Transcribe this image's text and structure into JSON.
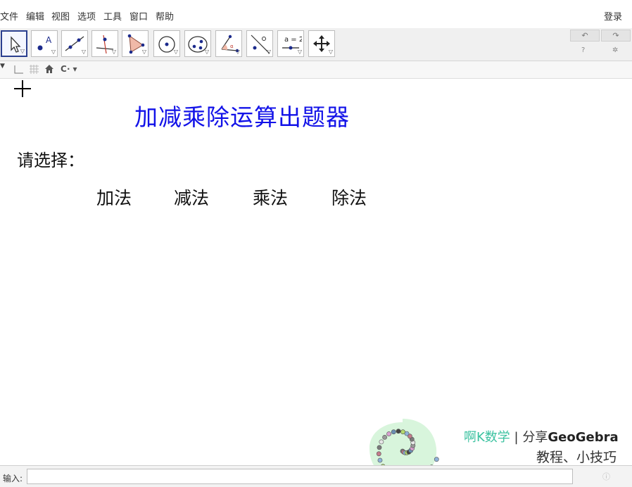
{
  "menu": {
    "items": [
      "文件",
      "编辑",
      "视图",
      "选项",
      "工具",
      "窗口",
      "帮助"
    ],
    "login": "登录"
  },
  "toolbar": {
    "tools": [
      {
        "name": "move-tool",
        "icon": "pointer-arrow-icon"
      },
      {
        "name": "point-tool",
        "icon": "point-icon"
      },
      {
        "name": "line-tool",
        "icon": "line-icon"
      },
      {
        "name": "perpendicular-tool",
        "icon": "perpendicular-icon"
      },
      {
        "name": "polygon-tool",
        "icon": "polygon-icon"
      },
      {
        "name": "circle-tool",
        "icon": "circle-icon"
      },
      {
        "name": "conic-tool",
        "icon": "ellipse-icon"
      },
      {
        "name": "angle-tool",
        "icon": "angle-icon"
      },
      {
        "name": "reflect-tool",
        "icon": "reflect-icon"
      },
      {
        "name": "slider-tool",
        "icon": "slider-icon",
        "label": "a = 2"
      },
      {
        "name": "move-graphics-tool",
        "icon": "move-arrows-icon"
      }
    ],
    "undo_icon": "undo-icon",
    "redo_icon": "redo-icon",
    "help_icon": "help-icon",
    "settings_icon": "gear-icon"
  },
  "stylebar": {
    "menu_icon": "triangle-menu-icon",
    "axes_icon": "axes-icon",
    "grid_icon": "grid-icon",
    "home_icon": "home-icon",
    "point_capture_label": "C"
  },
  "canvas": {
    "title": "加减乘除运算出题器",
    "prompt": "请选择：",
    "operations": [
      "加法",
      "减法",
      "乘法",
      "除法"
    ],
    "title_color": "#1212e8"
  },
  "watermark": {
    "brand": "啊K数学",
    "separator": "|",
    "share_prefix": "分享",
    "share_brand": "GeoGebra",
    "subtitle": "教程、小技巧",
    "brand_color": "#3cc2a0"
  },
  "inputbar": {
    "label": "输入:",
    "value": ""
  }
}
